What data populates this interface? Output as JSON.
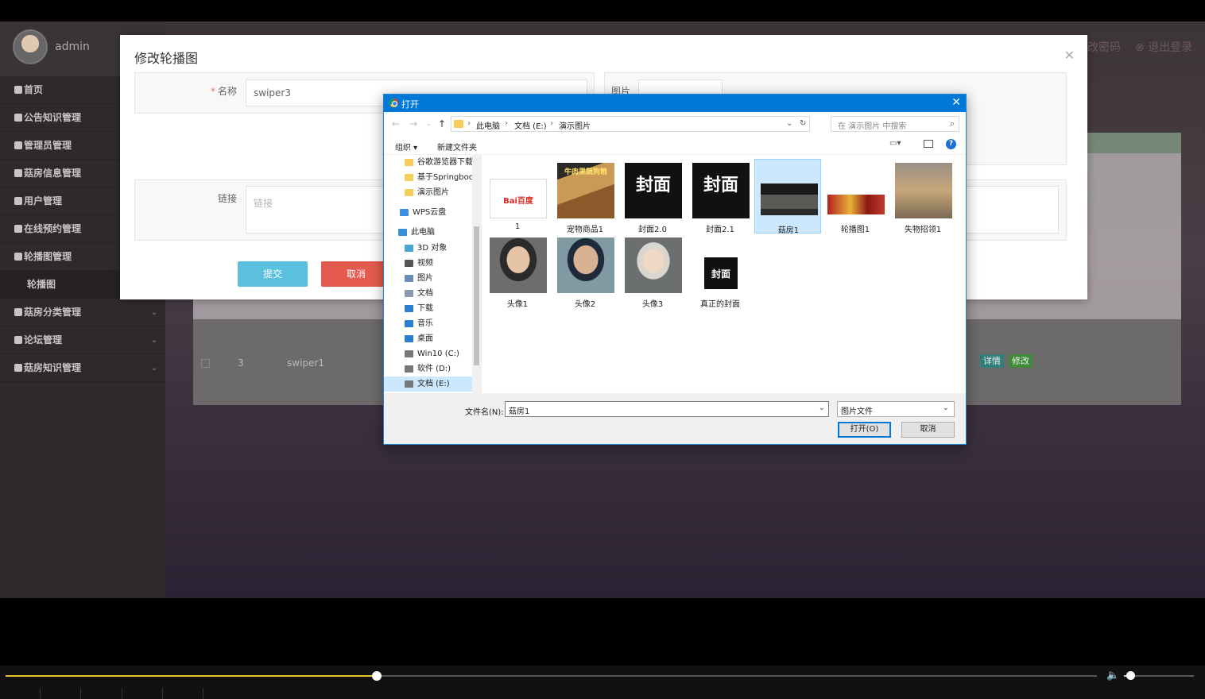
{
  "sidebar": {
    "username": "admin",
    "items": [
      {
        "label": "首页",
        "chevron": false
      },
      {
        "label": "公告知识管理",
        "chevron": false
      },
      {
        "label": "管理员管理",
        "chevron": false
      },
      {
        "label": "菇房信息管理",
        "chevron": false
      },
      {
        "label": "用户管理",
        "chevron": false
      },
      {
        "label": "在线预约管理",
        "chevron": false
      },
      {
        "label": "轮播图管理",
        "chevron": false
      },
      {
        "label": "轮播图",
        "chevron": false,
        "sub": true
      },
      {
        "label": "菇房分类管理",
        "chevron": true
      },
      {
        "label": "论坛管理",
        "chevron": true
      },
      {
        "label": "菇房知识管理",
        "chevron": true
      }
    ]
  },
  "header": {
    "change_password": "改密码",
    "logout": "退出登录"
  },
  "background_table": {
    "row_num": "3",
    "row_name": "swiper1",
    "detail_btn": "详情",
    "edit_btn": "修改",
    "colors": {
      "detail": "#2f7f7a",
      "edit": "#3e8a3a"
    }
  },
  "modal": {
    "title": "修改轮播图",
    "name_label": "名称",
    "name_value": "swiper3",
    "image_label": "图片",
    "link_label": "链接",
    "link_placeholder": "链接",
    "submit": "提交",
    "cancel": "取消",
    "colors": {
      "submit": "#5bc0de",
      "cancel": "#e55a4e"
    }
  },
  "file_dialog": {
    "title": "打开",
    "breadcrumb": [
      "此电脑",
      "文档 (E:)",
      "演示图片"
    ],
    "search_placeholder": "在 演示图片 中搜索",
    "organize": "组织 ▾",
    "new_folder": "新建文件夹",
    "nav_items": [
      {
        "label": "谷歌游览器下载",
        "icon": "folder-icon"
      },
      {
        "label": "基于Springboot",
        "icon": "folder-icon"
      },
      {
        "label": "演示图片",
        "icon": "folder-icon"
      },
      {
        "label": "WPS云盘",
        "icon": "cloud-icon"
      },
      {
        "label": "此电脑",
        "icon": "computer-icon"
      },
      {
        "label": "3D 对象",
        "icon": "cube-icon"
      },
      {
        "label": "视频",
        "icon": "video-icon"
      },
      {
        "label": "图片",
        "icon": "picture-icon"
      },
      {
        "label": "文档",
        "icon": "document-icon"
      },
      {
        "label": "下载",
        "icon": "download-icon"
      },
      {
        "label": "音乐",
        "icon": "music-icon"
      },
      {
        "label": "桌面",
        "icon": "desktop-icon"
      },
      {
        "label": "Win10 (C:)",
        "icon": "drive-icon"
      },
      {
        "label": "软件 (D:)",
        "icon": "drive-icon"
      },
      {
        "label": "文档 (E:)",
        "icon": "drive-icon",
        "selected": true
      }
    ],
    "files": [
      {
        "label": "1",
        "thumb_text": "Bai百度"
      },
      {
        "label": "宠物商品1",
        "thumb_text": "牛肉果蔬狗粮"
      },
      {
        "label": "封面2.0",
        "thumb_text": "封面"
      },
      {
        "label": "封面2.1",
        "thumb_text": "封面"
      },
      {
        "label": "菇房1",
        "thumb_text": "",
        "selected": true
      },
      {
        "label": "轮播图1",
        "thumb_text": ""
      },
      {
        "label": "失物招领1",
        "thumb_text": ""
      },
      {
        "label": "头像1",
        "thumb_text": ""
      },
      {
        "label": "头像2",
        "thumb_text": ""
      },
      {
        "label": "头像3",
        "thumb_text": ""
      },
      {
        "label": "真正的封面",
        "thumb_text": "封面"
      }
    ],
    "filename_label": "文件名(N):",
    "filename_value": "菇房1",
    "filetype": "图片文件",
    "open_btn": "打开(O)",
    "cancel_btn": "取消"
  },
  "player": {
    "progress": 0.34,
    "volume": 0.09
  }
}
